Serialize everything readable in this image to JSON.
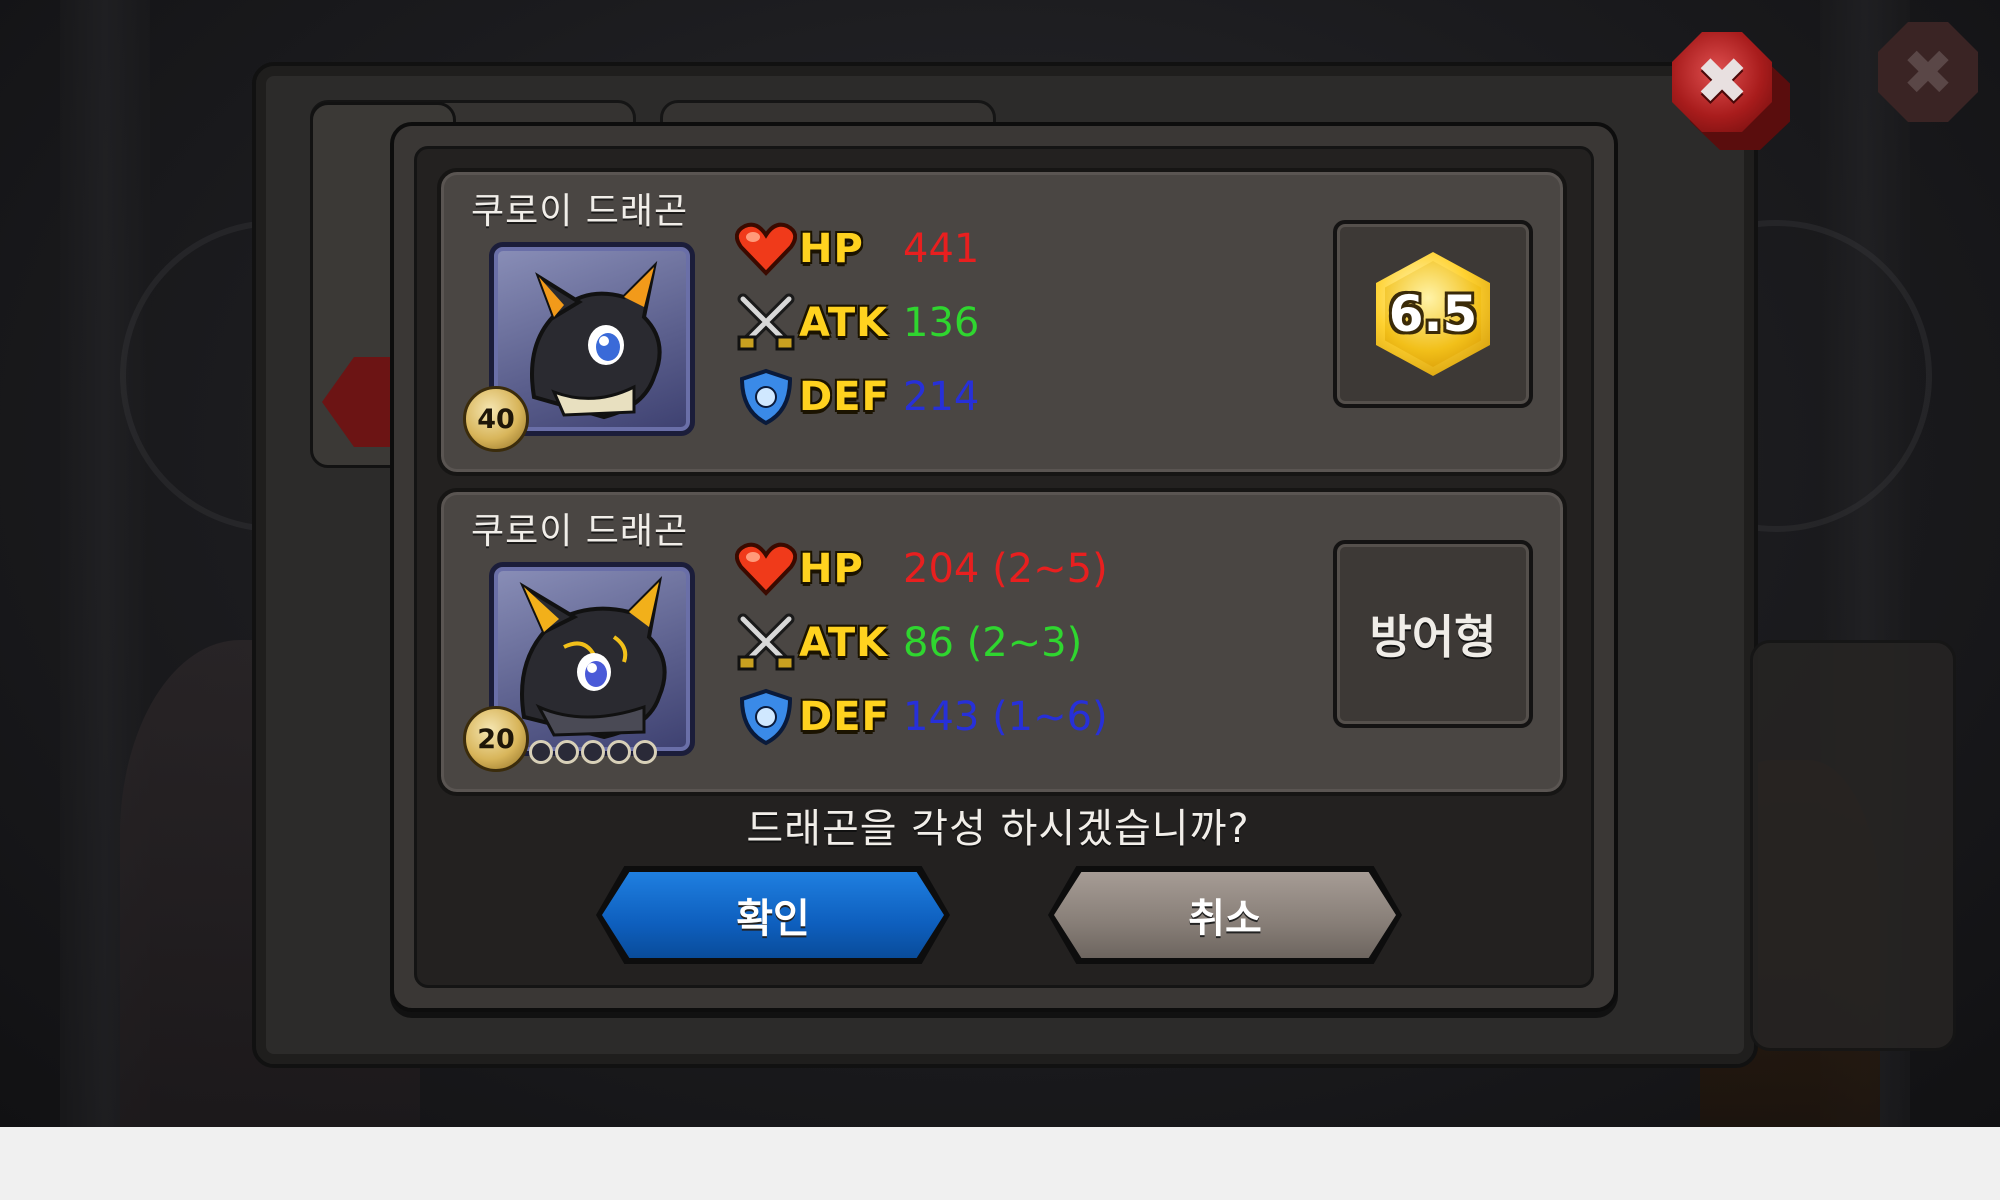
{
  "cards": [
    {
      "name": "쿠로이 드래곤",
      "level": "40",
      "stats": {
        "hp": {
          "label": "HP",
          "value": "441"
        },
        "atk": {
          "label": "ATK",
          "value": "136"
        },
        "def": {
          "label": "DEF",
          "value": "214"
        }
      },
      "badge": "6.5"
    },
    {
      "name": "쿠로이 드래곤",
      "level": "20",
      "stats": {
        "hp": {
          "label": "HP",
          "value": "204 (2~5)"
        },
        "atk": {
          "label": "ATK",
          "value": "86 (2~3)"
        },
        "def": {
          "label": "DEF",
          "value": "143 (1~6)"
        }
      },
      "type": "방어형"
    }
  ],
  "question": "드래곤을 각성 하시겠습니까?",
  "buttons": {
    "confirm": "확인",
    "cancel": "취소"
  },
  "close_label": "✖",
  "colors": {
    "hp": "#e81f1f",
    "atk": "#2fd62f",
    "def": "#2730d8",
    "confirm": "#1270d0",
    "cancel": "#8f857e"
  },
  "icons": {
    "hp": "heart-icon",
    "atk": "crossed-swords-icon",
    "def": "shield-icon",
    "close": "close-icon"
  }
}
